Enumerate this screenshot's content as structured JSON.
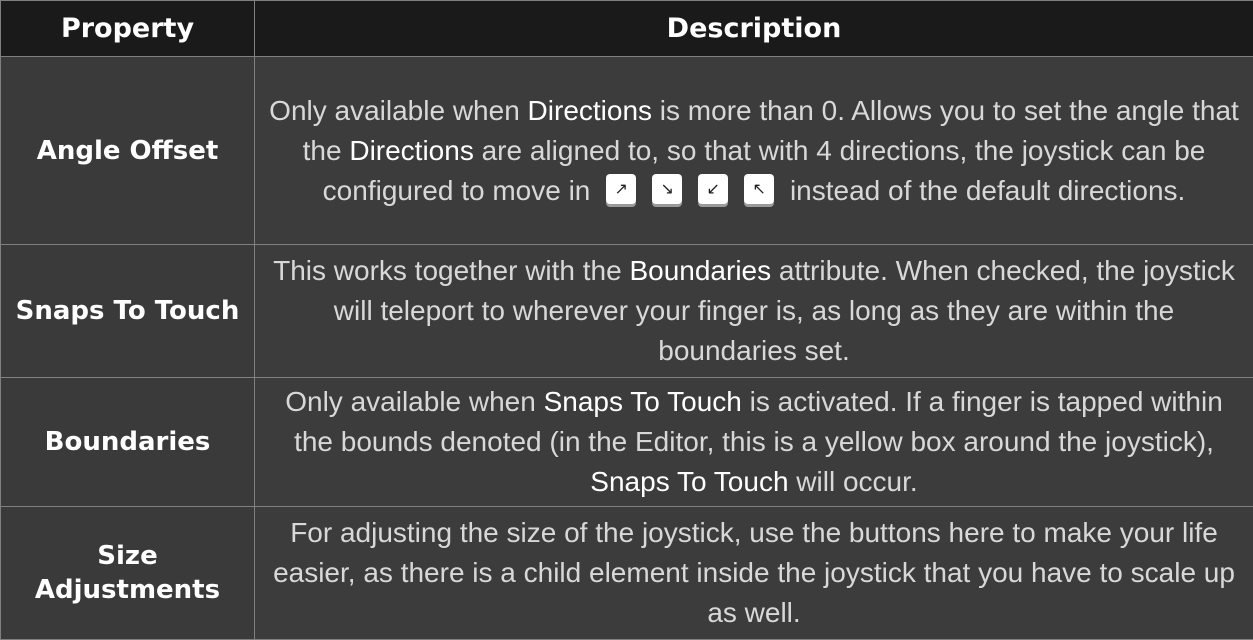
{
  "table": {
    "headers": [
      "Property",
      "Description"
    ],
    "rows": [
      {
        "property": "Angle Offset",
        "description": {
          "t1": "Only available when ",
          "k1": "Directions",
          "t2": " is more than 0. Allows you to set the angle that the ",
          "k2": "Directions",
          "t3": " are aligned to, so that with 4 directions, the joystick can be configured to move in",
          "keys": [
            "↗",
            "↘",
            "↙",
            "↖"
          ],
          "t4": "instead of the default directions."
        }
      },
      {
        "property": "Snaps To Touch",
        "description": {
          "t1": "This works together with the ",
          "k1": "Boundaries",
          "t2": " attribute. When checked, the joystick will teleport to wherever your finger is, as long as they are within the boundaries set."
        }
      },
      {
        "property": "Boundaries",
        "description": {
          "t1": "Only available when ",
          "k1": "Snaps To Touch",
          "t2": " is activated. If a finger is tapped within the bounds denoted (in the Editor, this is a yellow box around the joystick), ",
          "k2": "Snaps To Touch",
          "t3": " will occur."
        }
      },
      {
        "property": "Size Adjustments",
        "description": {
          "t1": "For adjusting the size of the joystick, use the buttons here to make your life easier, as there is a child element inside the joystick that you have to scale up as well."
        }
      }
    ]
  },
  "colors": {
    "header_bg": "#1a1a1a",
    "cell_bg": "#3c3c3c",
    "text": "#d8d8d8",
    "keyword": "#ffffff",
    "border": "#808080"
  }
}
